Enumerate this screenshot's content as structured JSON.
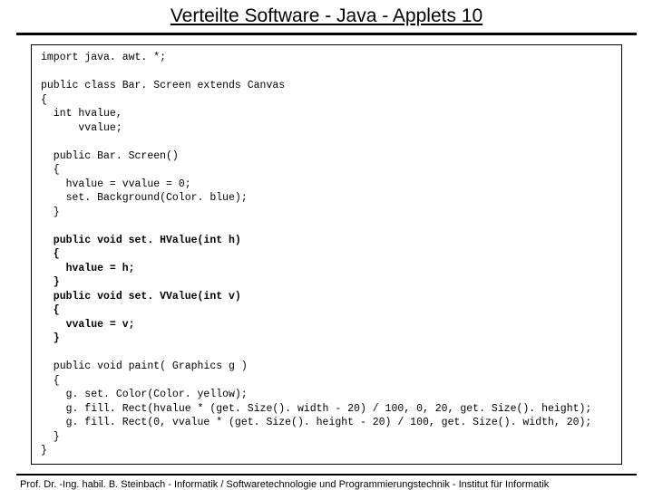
{
  "title": "Verteilte Software - Java - Applets 10",
  "code": {
    "l01": "import java. awt. *;",
    "l02": "",
    "l03": "public class Bar. Screen extends Canvas",
    "l04": "{",
    "l05": "  int hvalue,",
    "l06": "      vvalue;",
    "l07": "",
    "l08": "  public Bar. Screen()",
    "l09": "  {",
    "l10": "    hvalue = vvalue = 0;",
    "l11": "    set. Background(Color. blue);",
    "l12": "  }",
    "l13": "",
    "l14": "  public void set. HValue(int h)",
    "l15": "  {",
    "l16": "    hvalue = h;",
    "l17": "  }",
    "l18": "  public void set. VValue(int v)",
    "l19": "  {",
    "l20": "    vvalue = v;",
    "l21": "  }",
    "l22": "",
    "l23": "  public void paint( Graphics g )",
    "l24": "  {",
    "l25": "    g. set. Color(Color. yellow);",
    "l26": "    g. fill. Rect(hvalue * (get. Size(). width - 20) / 100, 0, 20, get. Size(). height);",
    "l27": "    g. fill. Rect(0, vvalue * (get. Size(). height - 20) / 100, get. Size(). width, 20);",
    "l28": "  }",
    "l29": "}"
  },
  "footer": "Prof. Dr. -Ing. habil. B. Steinbach - Informatik / Softwaretechnologie und Programmierungstechnik - Institut für Informatik"
}
